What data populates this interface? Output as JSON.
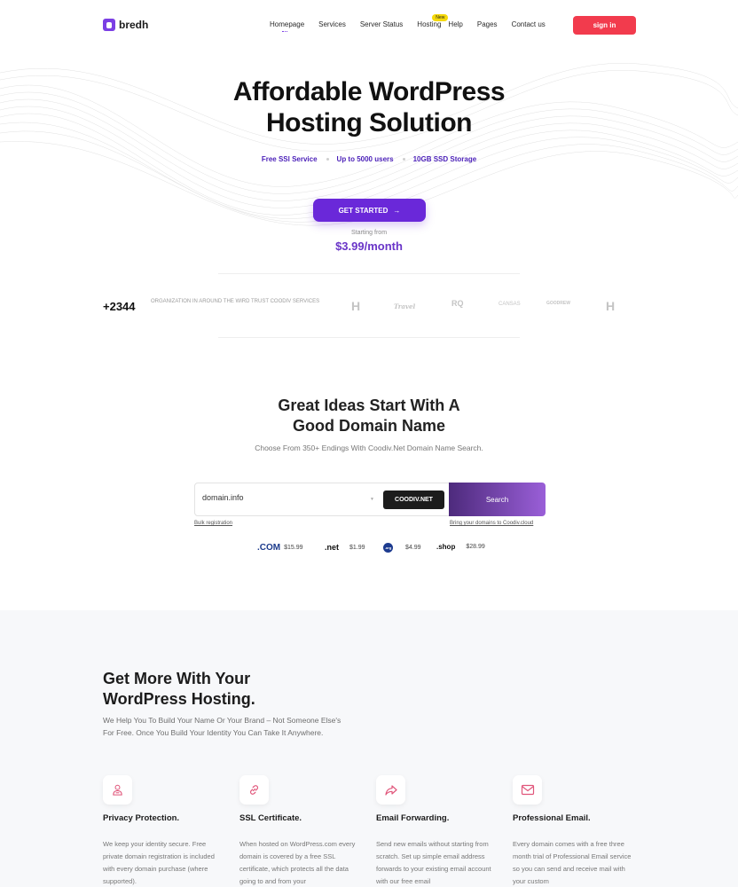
{
  "header": {
    "logo_text": "bredh",
    "nav": [
      {
        "label": "Homepage"
      },
      {
        "label": "Services"
      },
      {
        "label": "Server Status"
      },
      {
        "label": "Hosting",
        "badge": "New"
      },
      {
        "label": "Help"
      },
      {
        "label": "Pages"
      },
      {
        "label": "Contact us"
      }
    ],
    "signin_label": "sign in"
  },
  "hero": {
    "title_line1": "Affordable WordPress",
    "title_line2": "Hosting Solution",
    "features": [
      "Free SSl Service",
      "Up to 5000 users",
      "10GB SSD Storage"
    ],
    "cta_label": "GET STARTED",
    "starting_label": "Starting from",
    "price": "$3.99/month"
  },
  "trust": {
    "count": "+2344",
    "text": "ORGANIZATION IN AROUND THE WIRD TRUST COODIV SERVICES",
    "brands": [
      "H",
      "Travel",
      "RQ",
      "CANSAS",
      "GOODREW",
      "H"
    ]
  },
  "domain": {
    "title_line1": "Great Ideas Start With A",
    "title_line2": "Good Domain Name",
    "subtitle": "Choose From 350+ Endings With Coodiv.Net Domain Name Search.",
    "input_value": "domain.info",
    "tld_button": "COODIV.NET",
    "search_label": "Search",
    "bulk_link": "Bulk registration",
    "bring_link": "Bring your domains to Coodiv.cloud",
    "tlds": [
      {
        "name": ".COM",
        "price": "$15.99"
      },
      {
        "name": ".net",
        "price": "$1.99"
      },
      {
        "name": ".org",
        "price": "$4.99"
      },
      {
        "name": ".shop",
        "price": "$28.99"
      }
    ]
  },
  "more": {
    "title_line1": "Get More With Your",
    "title_line2": "WordPress Hosting.",
    "subtitle": "We Help You To Build Your Name Or Your Brand – Not Someone Else's For Free. Once You Build Your Identity You Can Take It Anywhere.",
    "cards": [
      {
        "icon": "privacy-icon",
        "title": "Privacy Protection.",
        "text": "We keep your identity secure. Free private domain registration is included with every domain purchase (where supported)."
      },
      {
        "icon": "link-icon",
        "title": "SSL Certificate.",
        "text": "When hosted on WordPress.com every domain is covered by a free SSL certificate, which protects all the data going to and from your"
      },
      {
        "icon": "forward-icon",
        "title": "Email Forwarding.",
        "text": "Send new emails without starting from scratch. Set up simple email address forwards to your existing email account with our free email"
      },
      {
        "icon": "email-icon",
        "title": "Professional Email.",
        "text": "Every domain comes with a free three month trial of Professional Email service so you can send and receive mail with your custom"
      }
    ]
  },
  "colors": {
    "accent": "#6a28d9",
    "signin": "#f23b4d",
    "feature_text": "#4a1fb8"
  }
}
